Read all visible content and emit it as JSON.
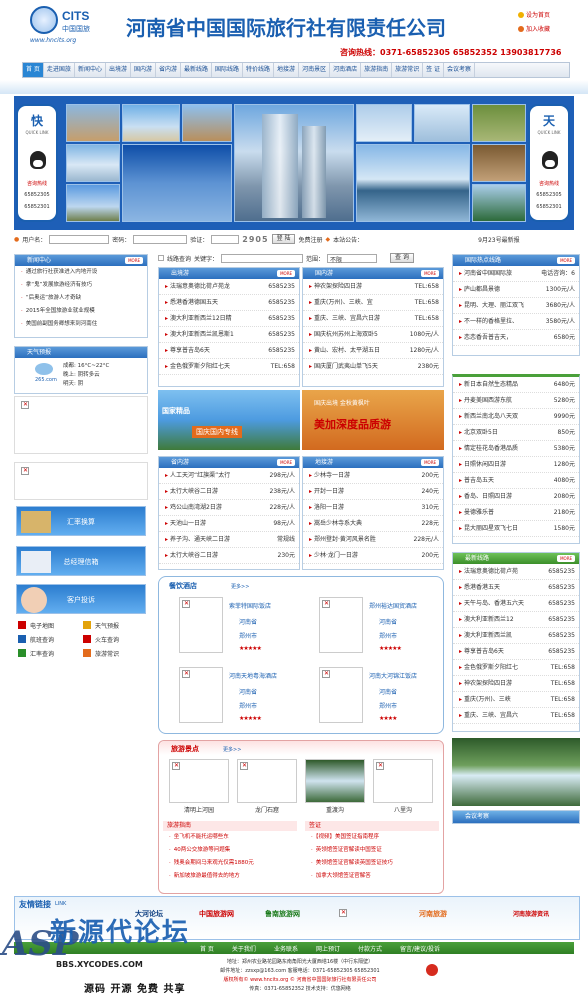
{
  "header": {
    "logo_cits": "CITS",
    "logo_cn": "中国国旅",
    "logo_url": "www.hncits.org",
    "title": "河南省中国国际旅行社有限责任公司",
    "set_home": "设为首页",
    "add_fav": "加入收藏",
    "hotline_label": "咨询热线：",
    "hotline_numbers": "0371-65852305  65852352  13903817736"
  },
  "nav": [
    "首 页",
    "走进国旅",
    "新闻中心",
    "出境游",
    "国内游",
    "省内游",
    "最新线路",
    "国际线路",
    "特价线路",
    "地接游",
    "河南景区",
    "河南酒店",
    "旅游指南",
    "旅游常识",
    "签 证",
    "会议考察"
  ],
  "banner": {
    "left_char": "快",
    "right_char": "天",
    "quick": "QUICK LINK",
    "hot": "咨询热线",
    "n1": "65852305",
    "n2": "65852301"
  },
  "login": {
    "user": "用户名：",
    "pass": "密码：",
    "code": "验证：",
    "code_val": "2905",
    "login_btn": "登 陆",
    "register": "免费注册",
    "notice": "本站公告：",
    "date_notice": "9月23号最新报"
  },
  "search": {
    "route": "线路查询",
    "keyword": "关键字：",
    "range": "范围：",
    "range_val": "不限",
    "btn": "查 询"
  },
  "news": {
    "title": "新闻中心",
    "more": "MORE",
    "items": [
      "通过旅行社获准进入内地开设",
      "拿“鬼”发展旅游经济有技巧",
      "“后奥运”旅游人才奇缺",
      "2015年全国旅游业就业规模",
      "美国前副国务卿想来到河南住"
    ]
  },
  "weather": {
    "title": "天气预报",
    "city": "成都: 16°C~22°C",
    "tonight": "晚上: 阴转多云",
    "tomorrow": "明天: 阴",
    "site": "265.com"
  },
  "services": [
    "汇率换算",
    "总经理信箱",
    "客户投诉"
  ],
  "tools": [
    "电子地图",
    "天气预报",
    "航班查询",
    "火车查询",
    "汇率查询",
    "旅游常识"
  ],
  "outbound": {
    "title": "出境游",
    "more": "MORE",
    "rows": [
      [
        "法瑞意奥德比荷卢苑龙",
        "6585235"
      ],
      [
        "悉港香港德国五天",
        "6585235"
      ],
      [
        "澳大利亚新西兰12日精",
        "6585235"
      ],
      [
        "澳大利亚新西兰凯恩斯1",
        "6585235"
      ],
      [
        "尊享普吉岛6天",
        "6585235"
      ],
      [
        "金色俄罗斯夕阳红七天",
        "TEL:658"
      ]
    ]
  },
  "domestic": {
    "title": "国内游",
    "more": "MORE",
    "rows": [
      [
        "神农架探险四日游",
        "TEL:658"
      ],
      [
        "重庆(万州)、三峡、宜",
        "TEL:658"
      ],
      [
        "重庆、三峡、宜昌六日游",
        "TEL:658"
      ],
      [
        "国庆杭州苏州上海双卧5",
        "1080元/人"
      ],
      [
        "黄山、宏村、太平湖五日",
        "1280元/人"
      ],
      [
        "国庆厦门武夷山单飞5天",
        "2380元"
      ]
    ]
  },
  "promo": {
    "left_caption": "国家精品",
    "left_banner": "国庆国内专线",
    "right_top": "国庆出境 金秋黄枫叶",
    "right_main": "美加深度品质游"
  },
  "province": {
    "title": "省内游",
    "more": "MORE",
    "rows": [
      [
        "人工天河“红旗渠”太行",
        "298元/人"
      ],
      [
        "太行大峡谷二日游",
        "238元/人"
      ],
      [
        "鸡公山南湾湖2日游",
        "228元/人"
      ],
      [
        "天池山一日游",
        "98元/人"
      ],
      [
        "养子沟、通天峡二日游",
        "常规线"
      ],
      [
        "太行大峡谷二日游",
        "230元"
      ]
    ]
  },
  "local": {
    "title": "地接游",
    "more": "MORE",
    "rows": [
      [
        "少林寺一日游",
        "200元"
      ],
      [
        "开封一日游",
        "240元"
      ],
      [
        "洛阳一日游",
        "310元"
      ],
      [
        "嵩岳少林寺系大典",
        "228元"
      ],
      [
        "郑州登封·黄河风景名胜",
        "228元/人"
      ],
      [
        "少林·龙门一日游",
        "200元"
      ]
    ]
  },
  "hotels": {
    "title": "餐饮酒店",
    "more": "更多>>",
    "items": [
      {
        "name": "索菲特国际饭店",
        "prov": "河南省",
        "city": "郑州市",
        "stars": "★★★★★"
      },
      {
        "name": "郑州裕达国贸酒店",
        "prov": "河南省",
        "city": "郑州市",
        "stars": "★★★★★"
      },
      {
        "name": "河南天地粤海酒店",
        "prov": "河南省",
        "city": "郑州市",
        "stars": "★★★★★"
      },
      {
        "name": "河南大河锦江饭店",
        "prov": "河南省",
        "city": "郑州市",
        "stars": "★★★★"
      }
    ]
  },
  "scenic": {
    "title": "旅游景点",
    "more": "更多>>",
    "items": [
      "清明上河园",
      "龙门石窟",
      "重渡沟",
      "八里沟"
    ]
  },
  "guide": {
    "title": "旅游指南",
    "items": [
      "坐飞机不能托运哪些东",
      "40两公交旅游等问题集",
      "残奥会期间马来观光仅需1880元",
      "新加坡旅游最值得去的地方"
    ]
  },
  "visa": {
    "title": "签证",
    "items": [
      "【视频】美国签证指南程序",
      "英领馆签证官解读中国签证",
      "美领馆签证官解读英国签证技巧",
      "加拿大领馆签证官解答"
    ]
  },
  "latest": {
    "title": "国际热点线路",
    "more": "MORE",
    "rows": [
      [
        "河南省中国国际旅",
        "电话咨询：6"
      ],
      [
        "庐山都昌景德",
        "1300元/人"
      ],
      [
        "昆明、大理、丽江双飞",
        "3680元/人"
      ],
      [
        "不一样的香格里拉、",
        "3580元/人"
      ],
      [
        "恋恋香吾普吉天，",
        "6580元"
      ]
    ]
  },
  "special": {
    "rows": [
      [
        "新日本自然生态精品",
        "6480元"
      ],
      [
        "丹麦美国西游东航",
        "5280元"
      ],
      [
        "新西兰南北岛八天双",
        "9990元"
      ],
      [
        "北京双卧5日",
        "850元"
      ],
      [
        "情定桂花岛香港品质",
        "5380元"
      ],
      [
        "日照休闲四日游",
        "1280元"
      ],
      [
        "普吉岛五天",
        "4080元"
      ],
      [
        "香岛、日照四日游",
        "2080元"
      ],
      [
        "曼德雅乐普",
        "2180元"
      ],
      [
        "昆大丽四星双飞七日",
        "1580元"
      ]
    ]
  },
  "newest": {
    "title": "最新线路",
    "more": "MORE",
    "rows": [
      [
        "法瑞意奥德比荷卢苑",
        "6585235"
      ],
      [
        "悉港香港五天",
        "6585235"
      ],
      [
        "天午与岛、香港五六天",
        "6585235"
      ],
      [
        "澳大利亚新西兰12",
        "6585235"
      ],
      [
        "澳大利亚新西兰凯",
        "6585235"
      ],
      [
        "尊享普吉岛6天",
        "6585235"
      ],
      [
        "金色俄罗斯夕阳红七",
        "TEL:658"
      ],
      [
        "神农架探险四日游",
        "TEL:658"
      ],
      [
        "重庆(万州)、三峡",
        "TEL:658"
      ],
      [
        "重庆、三峡、宜昌六",
        "TEL:658"
      ]
    ]
  },
  "meeting": {
    "title": "会议考察"
  },
  "links": {
    "title": "友情链接",
    "sub": "LINK",
    "items": [
      "大河论坛",
      "中国旅游网",
      "鲁南旅游网",
      "河南旅游",
      "河南旅游资讯"
    ]
  },
  "footer": {
    "links": [
      "首 页",
      "关于我们",
      "业务联系",
      "网上预订",
      "付款方式",
      "留言/建议/投诉"
    ],
    "address": "地址：郑州农业路花园路东南角阳光大厦西塔16楼（中行东隔壁）",
    "email": "邮件地址：zzsxp@163.com  客服电话：0371-65852305 65852301",
    "copyright": "版权所有© www.hncits.org  © 河南省中国国际旅行社有限责任公司",
    "fax": "传真：0371-65852352  技术支持：优悠网络"
  },
  "watermark": {
    "big": "新源代论坛",
    "url": "BBS.XYCODES.COM",
    "slogan": "源码  开源  免费  共享",
    "asp": "ASP"
  }
}
